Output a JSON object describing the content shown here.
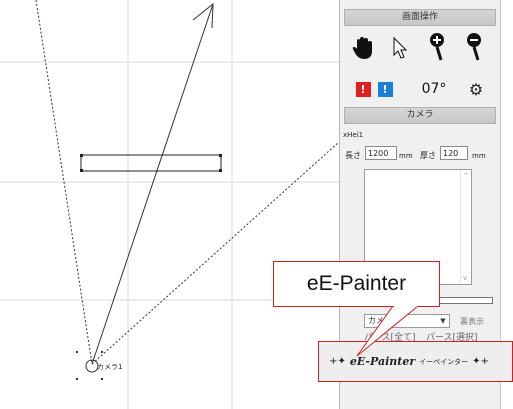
{
  "panel": {
    "view_ops_header": "画面操作",
    "camera_header": "カメラ",
    "tools": [
      {
        "icon": "hand-icon"
      },
      {
        "icon": "pointer-icon"
      },
      {
        "icon": "zoom-in-icon"
      },
      {
        "icon": "zoom-out-icon"
      }
    ],
    "tools_row2": [
      {
        "icon": "red-alert-icon",
        "glyph": "!",
        "color": "#e02020"
      },
      {
        "icon": "blue-alert-icon",
        "glyph": "!",
        "color": "#1c7fd8"
      },
      {
        "icon": "angle-icon",
        "glyph": "07°"
      },
      {
        "icon": "settings-icon",
        "glyph": "⚙"
      }
    ],
    "item_name": "xHei1",
    "length_label": "長さ",
    "length_value": "1200",
    "length_unit": "mm",
    "thickness_label": "厚さ",
    "thickness_value": "120",
    "thickness_unit": "mm",
    "camera_select": "カメラ1",
    "hide_label": "裏表示",
    "perse_all": "パース[全て]",
    "perse_selected": "パース[選択]",
    "logo_brand": "eE-Painter",
    "logo_kana": "イーペインター"
  },
  "canvas": {
    "camera_label": "カメラ1"
  },
  "callout": {
    "text": "eE-Painter"
  }
}
